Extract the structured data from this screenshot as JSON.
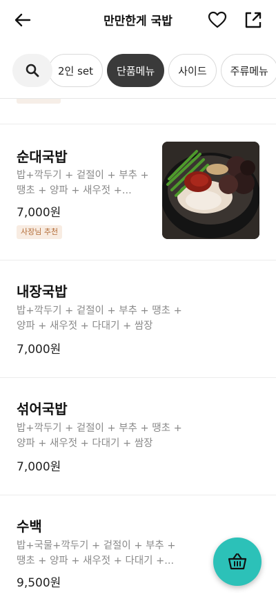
{
  "header": {
    "title": "만만한게 국밥"
  },
  "categories": [
    {
      "label": "2인 set",
      "active": false
    },
    {
      "label": "단품메뉴",
      "active": true
    },
    {
      "label": "사이드",
      "active": false
    },
    {
      "label": "주류메뉴",
      "active": false
    }
  ],
  "menu_items": [
    {
      "name": "순대국밥",
      "desc_line1": "밥+깍두기 + 겉절이 + 부추 +",
      "desc_line2": "땡초 + 양파 + 새우젓 +...",
      "price": "7,000원",
      "badge": "사장님 추천"
    },
    {
      "name": "내장국밥",
      "desc_line1": "밥+깍두기 + 겉절이 + 부추 + 땡초 +",
      "desc_line2": "양파 + 새우젓 + 다대기 + 쌈장",
      "price": "7,000원"
    },
    {
      "name": "섞어국밥",
      "desc_line1": "밥+깍두기 + 겉절이 + 부추 + 땡초 +",
      "desc_line2": "양파 + 새우젓 + 다대기 + 쌈장",
      "price": "7,000원"
    },
    {
      "name": "수백",
      "desc_line1": "밥+국물+깍두기 + 겉절이 + 부추 +",
      "desc_line2": "땡초 + 양파 + 새우젓 + 다대기 +...",
      "price": "9,500원"
    }
  ],
  "colors": {
    "active_chip": "#3a3a3a",
    "cart_button": "#2cc1b8",
    "badge_bg": "#f8ece2",
    "badge_text": "#b26b36"
  },
  "icons": {
    "back": "arrow-left-icon",
    "favorite": "heart-icon",
    "share": "share-icon",
    "search": "search-icon",
    "cart": "basket-icon"
  }
}
